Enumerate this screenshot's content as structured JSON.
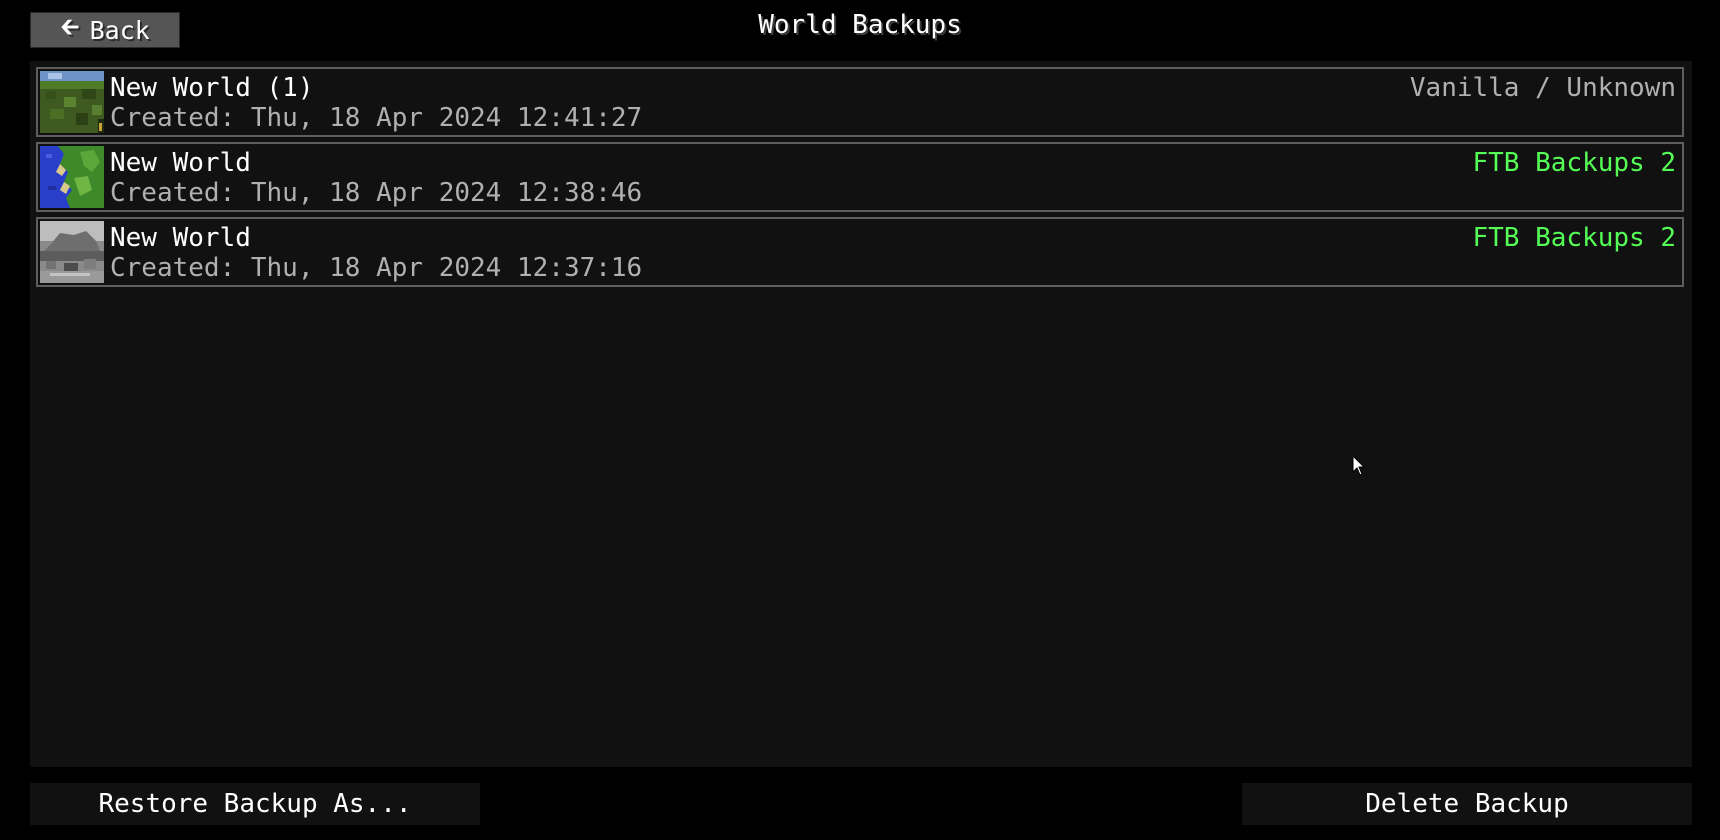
{
  "header": {
    "back_label": "Back",
    "title": "World Backups"
  },
  "backups": [
    {
      "name": "New World (1)",
      "created": "Created: Thu, 18 Apr 2024 12:41:27",
      "source": "Vanilla / Unknown",
      "source_color": "#b0b0b0",
      "thumbnail": "grass-block-world-thumbnail"
    },
    {
      "name": "New World",
      "created": "Created: Thu, 18 Apr 2024 12:38:46",
      "source": "FTB Backups 2",
      "source_color": "#55ff55",
      "thumbnail": "map-world-thumbnail"
    },
    {
      "name": "New World",
      "created": "Created: Thu, 18 Apr 2024 12:37:16",
      "source": "FTB Backups 2",
      "source_color": "#55ff55",
      "thumbnail": "grey-world-thumbnail"
    }
  ],
  "footer": {
    "restore_label": "Restore Backup As...",
    "delete_label": "Delete Backup"
  },
  "colors": {
    "background": "#000000",
    "panel": "#111111",
    "row_border": "#5e5e5e",
    "button": "#555555",
    "ftb_green": "#55ff55",
    "muted_text": "#b0b0b0"
  }
}
